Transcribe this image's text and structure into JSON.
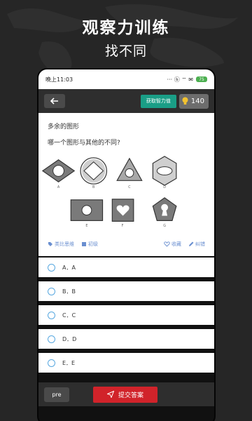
{
  "promo": {
    "title": "观察力训练",
    "subtitle": "找不同"
  },
  "statusbar": {
    "time": "晚上11:03",
    "icons_text": "··· ⓑ ⌔ ✉",
    "battery": "75"
  },
  "toolbar": {
    "back_icon": "arrow-left-icon",
    "hint_button": "获取智力值",
    "score_icon": "bulb-icon",
    "score": "140"
  },
  "question": {
    "category": "多余的图形",
    "text": "哪一个图形与其他的不同?",
    "figure_labels": [
      "A",
      "B",
      "C",
      "D",
      "E",
      "F",
      "G"
    ]
  },
  "card_actions": {
    "tag1": "类比思维",
    "tag2": "初级",
    "favorite": "收藏",
    "report": "纠错"
  },
  "options": [
    {
      "label": "A．A"
    },
    {
      "label": "B．B"
    },
    {
      "label": "C．C"
    },
    {
      "label": "D．D"
    },
    {
      "label": "E．E"
    }
  ],
  "bottombar": {
    "pre_button": "pre",
    "submit_button": "提交答案"
  },
  "colors": {
    "accent_green": "#1a9e86",
    "submit_red": "#d1232a",
    "link_blue": "#6a8fd0"
  }
}
